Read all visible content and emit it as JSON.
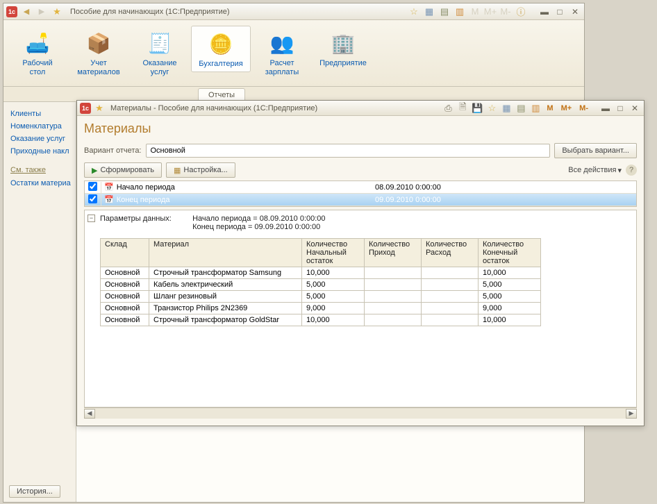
{
  "main": {
    "title": "Пособие для начинающих  (1С:Предприятие)",
    "toolbar": [
      {
        "label": "Рабочий\nстол",
        "icon": "🛋️"
      },
      {
        "label": "Учет\nматериалов",
        "icon": "📦"
      },
      {
        "label": "Оказание\nуслуг",
        "icon": "🧾"
      },
      {
        "label": "Бухгалтерия",
        "icon": "🪙",
        "active": true
      },
      {
        "label": "Расчет\nзарплаты",
        "icon": "👥"
      },
      {
        "label": "Предприятие",
        "icon": "🏢"
      }
    ],
    "subtab": "Отчеты",
    "sidebar": {
      "links": [
        "Клиенты",
        "Номенклатура",
        "Оказание услуг",
        "Приходные накл"
      ],
      "see_also_header": "См. также",
      "see_also": [
        "Остатки материа"
      ]
    },
    "history_btn": "История..."
  },
  "report": {
    "window_title": "Материалы - Пособие для начинающих  (1С:Предприятие)",
    "heading": "Материалы",
    "variant_label": "Вариант отчета:",
    "variant_value": "Основной",
    "choose_variant": "Выбрать вариант...",
    "form_btn": "Сформировать",
    "settings_btn": "Настройка...",
    "all_actions": "Все действия",
    "m_buttons": [
      "M",
      "M+",
      "M-"
    ],
    "periods": [
      {
        "checked": true,
        "label": "Начало периода",
        "value": "08.09.2010 0:00:00",
        "selected": false
      },
      {
        "checked": true,
        "label": "Конец периода",
        "value": "09.09.2010 0:00:00",
        "selected": true
      }
    ],
    "params_title": "Параметры данных:",
    "params_lines": [
      "Начало периода = 08.09.2010 0:00:00",
      "Конец периода = 09.09.2010 0:00:00"
    ],
    "columns": [
      "Склад",
      "Материал",
      "Количество Начальный остаток",
      "Количество Приход",
      "Количество Расход",
      "Количество Конечный остаток"
    ],
    "rows": [
      {
        "warehouse": "Основной",
        "material": "Строчный трансформатор Samsung",
        "start": "10,000",
        "in": "",
        "out": "",
        "end": "10,000"
      },
      {
        "warehouse": "Основной",
        "material": "Кабель электрический",
        "start": "5,000",
        "in": "",
        "out": "",
        "end": "5,000"
      },
      {
        "warehouse": "Основной",
        "material": "Шланг резиновый",
        "start": "5,000",
        "in": "",
        "out": "",
        "end": "5,000"
      },
      {
        "warehouse": "Основной",
        "material": "Транзистор Philips 2N2369",
        "start": "9,000",
        "in": "",
        "out": "",
        "end": "9,000"
      },
      {
        "warehouse": "Основной",
        "material": "Строчный трансформатор GoldStar",
        "start": "10,000",
        "in": "",
        "out": "",
        "end": "10,000"
      }
    ]
  }
}
